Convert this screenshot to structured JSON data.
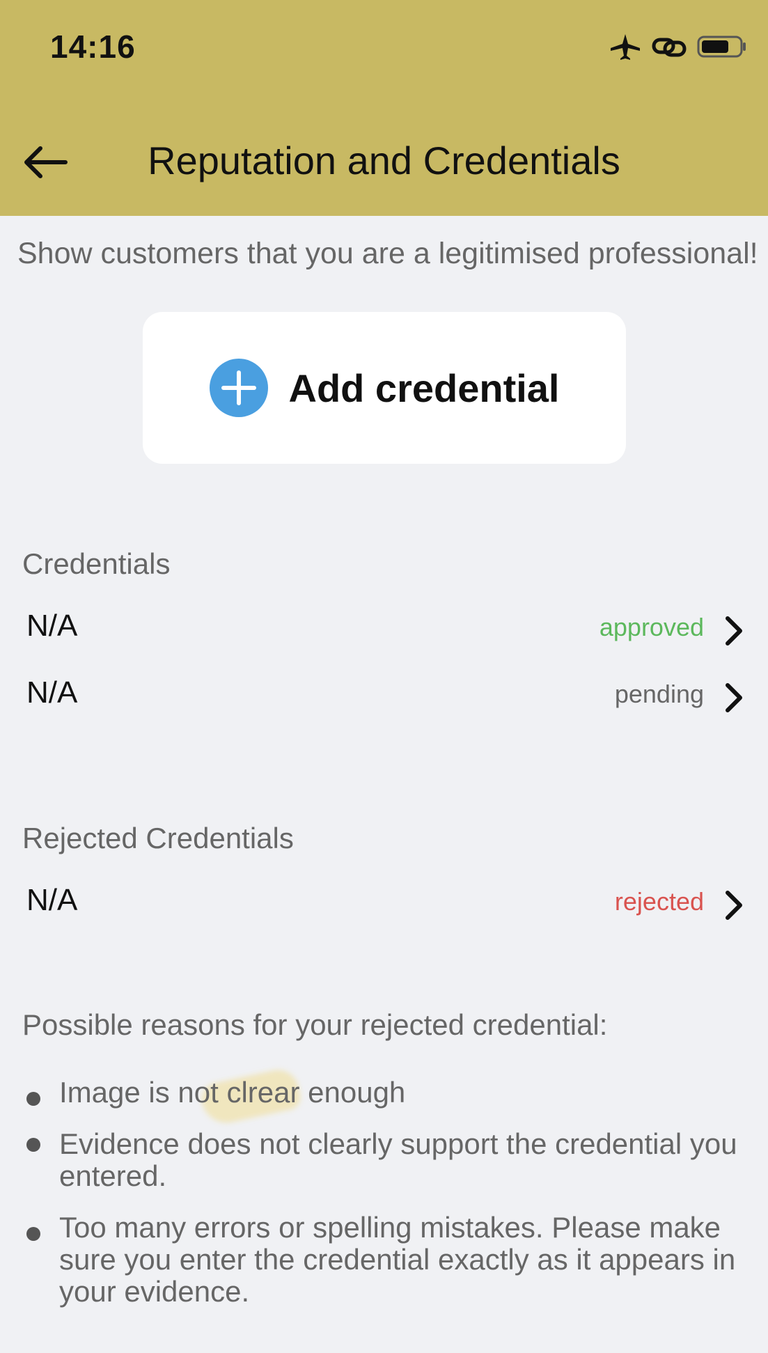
{
  "status_bar": {
    "time": "14:16",
    "icons": [
      "airplane-icon",
      "link-icon",
      "battery-icon"
    ]
  },
  "header": {
    "title": "Reputation and Credentials",
    "background_color": "#c8b963"
  },
  "subtitle": "Show customers that you are a legitimised professional!",
  "add_button": {
    "label": "Add credential",
    "icon": "plus-circle-icon",
    "icon_color": "#4a9fe0"
  },
  "credentials": {
    "heading": "Credentials",
    "items": [
      {
        "name": "N/A",
        "status": "approved",
        "status_color": "#5cb85c"
      },
      {
        "name": "N/A",
        "status": "pending",
        "status_color": "#666666"
      }
    ]
  },
  "rejected_credentials": {
    "heading": "Rejected Credentials",
    "items": [
      {
        "name": "N/A",
        "status": "rejected",
        "status_color": "#d9534f"
      }
    ]
  },
  "reasons": {
    "heading": "Possible reasons for your rejected credential:",
    "items": [
      "Image is not clrear enough",
      "Evidence does not clearly support the credential you entered.",
      "Too many errors or spelling mistakes. Please make sure you enter the credential exactly as it appears in your evidence."
    ]
  }
}
